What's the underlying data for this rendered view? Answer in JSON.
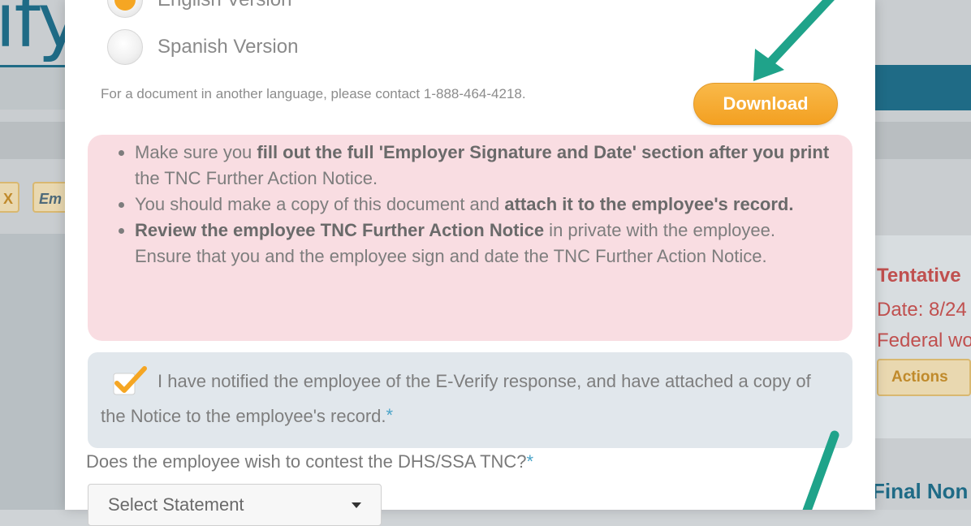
{
  "background": {
    "brand_fragment": "ify",
    "tag_x": "X",
    "tag_em": "Em",
    "right_status": "Tentative",
    "right_date": "Date: 8/24",
    "right_federal": "Federal wo",
    "actions_label": "Actions",
    "final_label": "Final Non"
  },
  "modal": {
    "language_options": [
      {
        "label": "English Version",
        "selected": true
      },
      {
        "label": "Spanish Version",
        "selected": false
      }
    ],
    "contact_note": "For a document in another language, please contact 1-888-464-4218.",
    "download_label": "Download",
    "notice": {
      "b1_pre": "Make sure you ",
      "b1_bold": "fill out the full 'Employer Signature and Date' section after you print",
      "b1_post": " the TNC Further Action Notice.",
      "b2_pre": "You should make a copy of this document and ",
      "b2_bold": "attach it to the employee's record.",
      "b3_bold": "Review the employee TNC Further Action Notice",
      "b3_post": " in private with the employee. Ensure that you and the employee sign and date the TNC Further Action Notice."
    },
    "acknowledgement": {
      "checked": true,
      "text": "I have notified the employee of the E-Verify response, and have attached a copy of the Notice to the employee's record.",
      "required_mark": "*"
    },
    "contest_question": "Does the employee wish to contest the DHS/SSA TNC?",
    "contest_required_mark": "*",
    "select_value": "Select Statement"
  },
  "colors": {
    "accent_orange": "#f5a623",
    "brand_teal": "#1f6b86",
    "arrow_green": "#1fa38a",
    "notice_pink": "#f9dde2",
    "ack_blue_gray": "#e1e7ec"
  }
}
